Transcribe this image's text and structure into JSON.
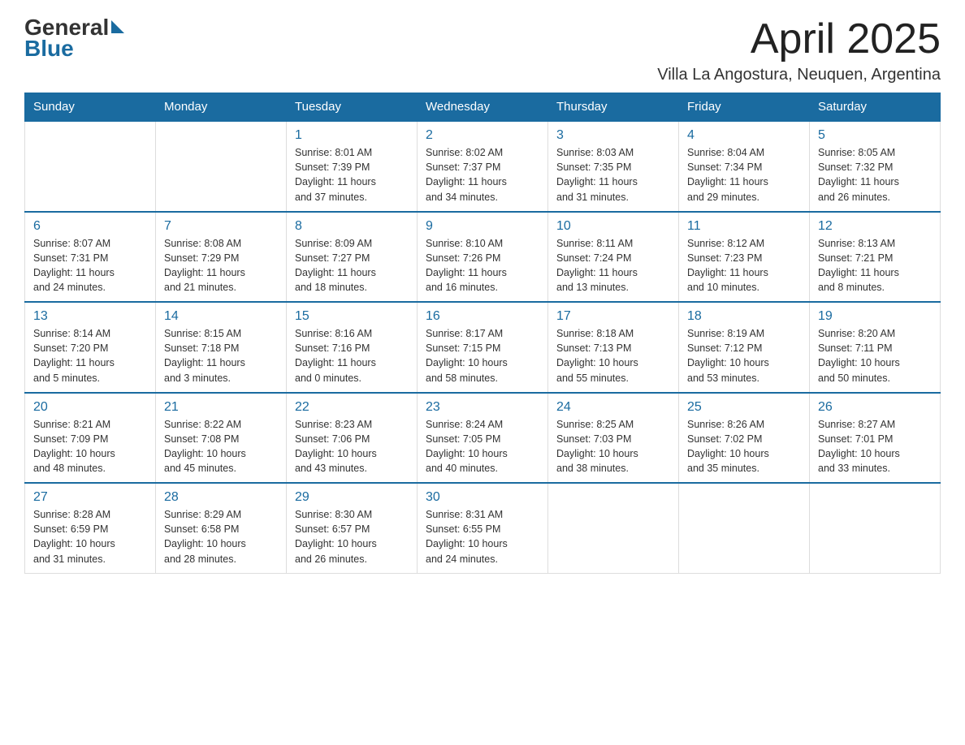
{
  "header": {
    "logo_general": "General",
    "logo_blue": "Blue",
    "month_title": "April 2025",
    "location": "Villa La Angostura, Neuquen, Argentina"
  },
  "days_of_week": [
    "Sunday",
    "Monday",
    "Tuesday",
    "Wednesday",
    "Thursday",
    "Friday",
    "Saturday"
  ],
  "weeks": [
    [
      {
        "day": "",
        "info": ""
      },
      {
        "day": "",
        "info": ""
      },
      {
        "day": "1",
        "info": "Sunrise: 8:01 AM\nSunset: 7:39 PM\nDaylight: 11 hours\nand 37 minutes."
      },
      {
        "day": "2",
        "info": "Sunrise: 8:02 AM\nSunset: 7:37 PM\nDaylight: 11 hours\nand 34 minutes."
      },
      {
        "day": "3",
        "info": "Sunrise: 8:03 AM\nSunset: 7:35 PM\nDaylight: 11 hours\nand 31 minutes."
      },
      {
        "day": "4",
        "info": "Sunrise: 8:04 AM\nSunset: 7:34 PM\nDaylight: 11 hours\nand 29 minutes."
      },
      {
        "day": "5",
        "info": "Sunrise: 8:05 AM\nSunset: 7:32 PM\nDaylight: 11 hours\nand 26 minutes."
      }
    ],
    [
      {
        "day": "6",
        "info": "Sunrise: 8:07 AM\nSunset: 7:31 PM\nDaylight: 11 hours\nand 24 minutes."
      },
      {
        "day": "7",
        "info": "Sunrise: 8:08 AM\nSunset: 7:29 PM\nDaylight: 11 hours\nand 21 minutes."
      },
      {
        "day": "8",
        "info": "Sunrise: 8:09 AM\nSunset: 7:27 PM\nDaylight: 11 hours\nand 18 minutes."
      },
      {
        "day": "9",
        "info": "Sunrise: 8:10 AM\nSunset: 7:26 PM\nDaylight: 11 hours\nand 16 minutes."
      },
      {
        "day": "10",
        "info": "Sunrise: 8:11 AM\nSunset: 7:24 PM\nDaylight: 11 hours\nand 13 minutes."
      },
      {
        "day": "11",
        "info": "Sunrise: 8:12 AM\nSunset: 7:23 PM\nDaylight: 11 hours\nand 10 minutes."
      },
      {
        "day": "12",
        "info": "Sunrise: 8:13 AM\nSunset: 7:21 PM\nDaylight: 11 hours\nand 8 minutes."
      }
    ],
    [
      {
        "day": "13",
        "info": "Sunrise: 8:14 AM\nSunset: 7:20 PM\nDaylight: 11 hours\nand 5 minutes."
      },
      {
        "day": "14",
        "info": "Sunrise: 8:15 AM\nSunset: 7:18 PM\nDaylight: 11 hours\nand 3 minutes."
      },
      {
        "day": "15",
        "info": "Sunrise: 8:16 AM\nSunset: 7:16 PM\nDaylight: 11 hours\nand 0 minutes."
      },
      {
        "day": "16",
        "info": "Sunrise: 8:17 AM\nSunset: 7:15 PM\nDaylight: 10 hours\nand 58 minutes."
      },
      {
        "day": "17",
        "info": "Sunrise: 8:18 AM\nSunset: 7:13 PM\nDaylight: 10 hours\nand 55 minutes."
      },
      {
        "day": "18",
        "info": "Sunrise: 8:19 AM\nSunset: 7:12 PM\nDaylight: 10 hours\nand 53 minutes."
      },
      {
        "day": "19",
        "info": "Sunrise: 8:20 AM\nSunset: 7:11 PM\nDaylight: 10 hours\nand 50 minutes."
      }
    ],
    [
      {
        "day": "20",
        "info": "Sunrise: 8:21 AM\nSunset: 7:09 PM\nDaylight: 10 hours\nand 48 minutes."
      },
      {
        "day": "21",
        "info": "Sunrise: 8:22 AM\nSunset: 7:08 PM\nDaylight: 10 hours\nand 45 minutes."
      },
      {
        "day": "22",
        "info": "Sunrise: 8:23 AM\nSunset: 7:06 PM\nDaylight: 10 hours\nand 43 minutes."
      },
      {
        "day": "23",
        "info": "Sunrise: 8:24 AM\nSunset: 7:05 PM\nDaylight: 10 hours\nand 40 minutes."
      },
      {
        "day": "24",
        "info": "Sunrise: 8:25 AM\nSunset: 7:03 PM\nDaylight: 10 hours\nand 38 minutes."
      },
      {
        "day": "25",
        "info": "Sunrise: 8:26 AM\nSunset: 7:02 PM\nDaylight: 10 hours\nand 35 minutes."
      },
      {
        "day": "26",
        "info": "Sunrise: 8:27 AM\nSunset: 7:01 PM\nDaylight: 10 hours\nand 33 minutes."
      }
    ],
    [
      {
        "day": "27",
        "info": "Sunrise: 8:28 AM\nSunset: 6:59 PM\nDaylight: 10 hours\nand 31 minutes."
      },
      {
        "day": "28",
        "info": "Sunrise: 8:29 AM\nSunset: 6:58 PM\nDaylight: 10 hours\nand 28 minutes."
      },
      {
        "day": "29",
        "info": "Sunrise: 8:30 AM\nSunset: 6:57 PM\nDaylight: 10 hours\nand 26 minutes."
      },
      {
        "day": "30",
        "info": "Sunrise: 8:31 AM\nSunset: 6:55 PM\nDaylight: 10 hours\nand 24 minutes."
      },
      {
        "day": "",
        "info": ""
      },
      {
        "day": "",
        "info": ""
      },
      {
        "day": "",
        "info": ""
      }
    ]
  ]
}
